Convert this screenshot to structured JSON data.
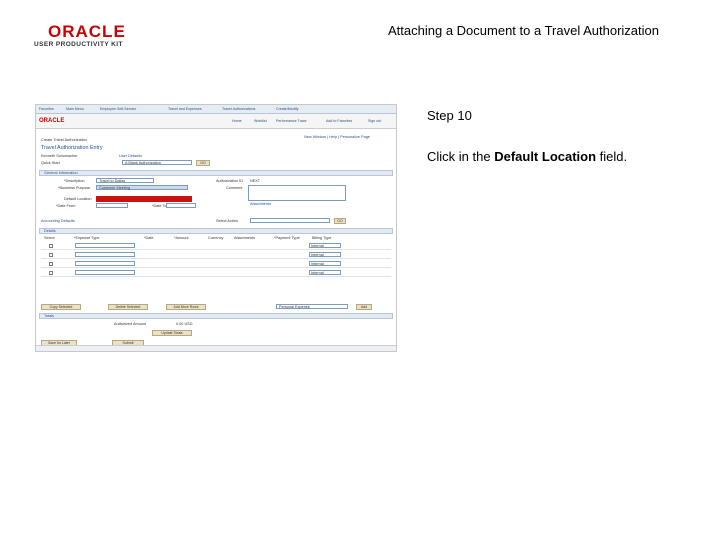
{
  "header": {
    "logo_main": "ORACLE",
    "logo_sub": "USER PRODUCTIVITY KIT",
    "title": "Attaching a Document to a Travel Authorization"
  },
  "step": {
    "label": "Step 10",
    "instruction_prefix": "Click in the ",
    "instruction_bold": "Default Location",
    "instruction_suffix": " field."
  },
  "screenshot": {
    "nav_links": [
      "Favorites",
      "Main Menu",
      "Employee Self-Service",
      "Travel and Expenses",
      "Travel Authorizations",
      "Create/Modify"
    ],
    "top_links": [
      "Home",
      "Worklist",
      "Performance Trace",
      "Add to Favorites",
      "Sign out"
    ],
    "mini_logo": "ORACLE",
    "page_links": "New Window | Help | Personalize Page",
    "breadcrumb": "Create Travel Authorization",
    "page_heading": "Travel Authorization Entry",
    "employee_name": "Kenneth Schumacher",
    "user_defaults": "User Defaults",
    "quick_start_label": "Quick Start",
    "quick_start_value": "A Blank Authorization",
    "go": "GO",
    "general_info": "General Information",
    "description_label": "*Description",
    "description_value": "Travel to Dallas",
    "business_purpose_label": "*Business Purpose",
    "business_purpose_value": "Customer Meeting",
    "authorization_id_label": "Authorization ID",
    "authorization_id_value": "NEXT",
    "comment_label": "Comment",
    "default_location_label": "Default Location",
    "date_from_label": "*Date From",
    "date_to_label": "*Date To",
    "attachments_link": "Attachments",
    "accounting_defaults": "Accounting Defaults",
    "details_label": "Details",
    "actions_label": "Select Action",
    "grid_columns": [
      "Select",
      "*Expense Type",
      "*Date",
      "*Amount",
      "Currency",
      "Attachments",
      "*Payment Type",
      "Billing Type"
    ],
    "grid_rows": [
      {
        "billing": "Internal"
      },
      {
        "billing": "Internal"
      },
      {
        "billing": "Internal"
      },
      {
        "billing": "Internal"
      }
    ],
    "copy_selected": "Copy Selected",
    "delete_selected": "Delete Selected",
    "add_more_rows": "Add More Rows",
    "billing_select": "Personal Expense",
    "add_btn": "Add",
    "totals": "Totals",
    "authorized_amount_label": "Authorized Amount",
    "authorized_amount_value": "0.00 USD",
    "update_totals": "Update Totals",
    "save_for_later": "Save for Later",
    "submit": "Submit",
    "delete": "Delete"
  }
}
